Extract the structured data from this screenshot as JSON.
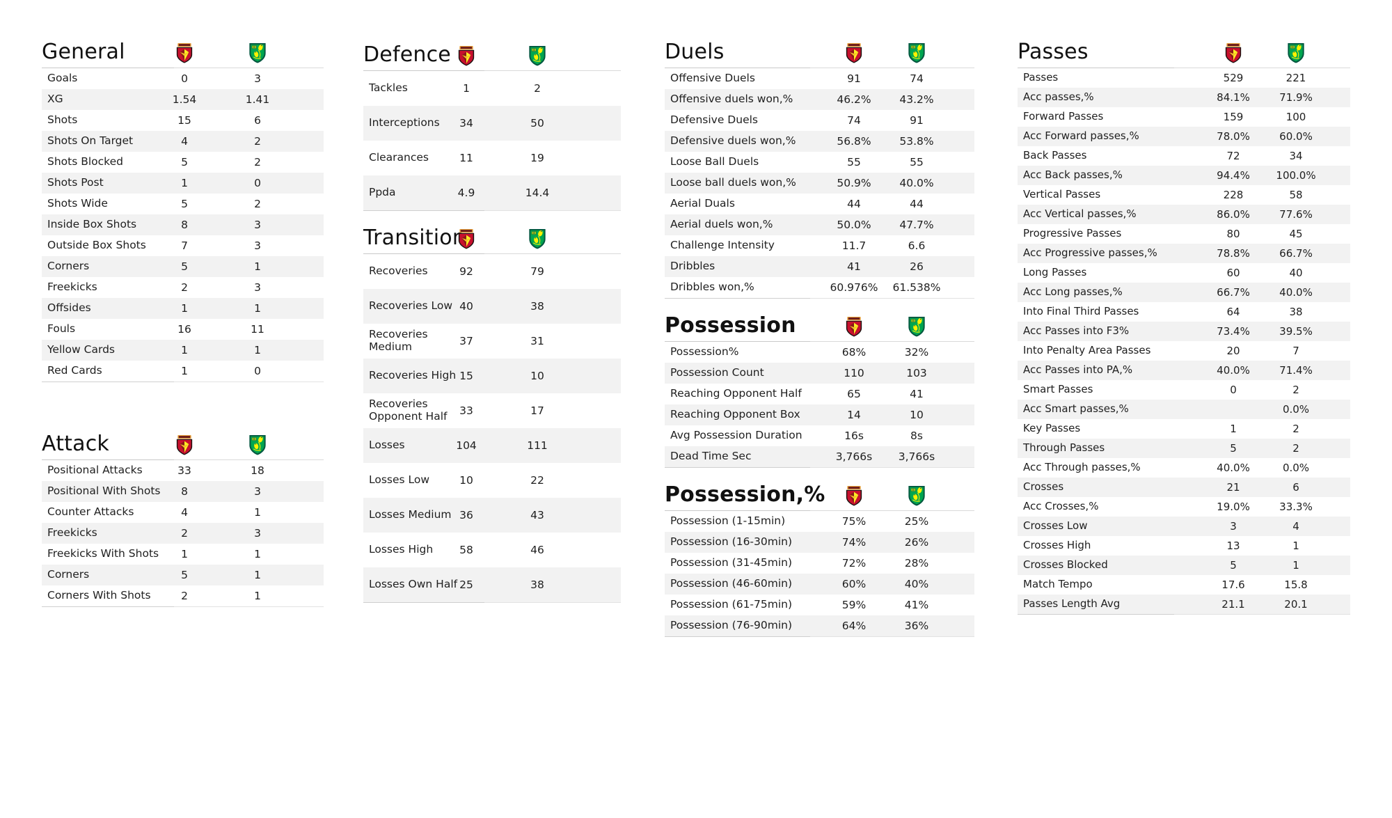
{
  "teams": {
    "home": {
      "name": "Watford",
      "crest": "watford-crest",
      "colors": {
        "primary": "#FBEE23",
        "secondary": "#ED2127",
        "dark": "#231F20"
      }
    },
    "away": {
      "name": "Norwich City",
      "crest": "norwich-city-crest",
      "colors": {
        "primary": "#00A650",
        "secondary": "#FFF200",
        "dark": "#00573F"
      }
    }
  },
  "theme": {
    "row_alt_bg": "#f2f2f2",
    "row_bg": "#ffffff",
    "rule": "#d9d9d9",
    "text": "#1f1f1f"
  },
  "columns": [
    {
      "name": "column-1",
      "sections": [
        {
          "title": "General",
          "bold": false,
          "rows": [
            {
              "label": "Goals",
              "home": "0",
              "away": "3"
            },
            {
              "label": "XG",
              "home": "1.54",
              "away": "1.41"
            },
            {
              "label": "Shots",
              "home": "15",
              "away": "6"
            },
            {
              "label": "Shots On Target",
              "home": "4",
              "away": "2"
            },
            {
              "label": "Shots Blocked",
              "home": "5",
              "away": "2"
            },
            {
              "label": "Shots Post",
              "home": "1",
              "away": "0"
            },
            {
              "label": "Shots Wide",
              "home": "5",
              "away": "2"
            },
            {
              "label": "Inside Box Shots",
              "home": "8",
              "away": "3"
            },
            {
              "label": "Outside Box Shots",
              "home": "7",
              "away": "3"
            },
            {
              "label": "Corners",
              "home": "5",
              "away": "1"
            },
            {
              "label": "Freekicks",
              "home": "2",
              "away": "3"
            },
            {
              "label": "Offsides",
              "home": "1",
              "away": "1"
            },
            {
              "label": "Fouls",
              "home": "16",
              "away": "11"
            },
            {
              "label": "Yellow Cards",
              "home": "1",
              "away": "1"
            },
            {
              "label": "Red Cards",
              "home": "1",
              "away": "0"
            }
          ]
        },
        {
          "title": "Attack",
          "bold": false,
          "rows": [
            {
              "label": "Positional Attacks",
              "home": "33",
              "away": "18"
            },
            {
              "label": "Positional With Shots",
              "home": "8",
              "away": "3"
            },
            {
              "label": "Counter Attacks",
              "home": "4",
              "away": "1"
            },
            {
              "label": "Freekicks",
              "home": "2",
              "away": "3"
            },
            {
              "label": "Freekicks With Shots",
              "home": "1",
              "away": "1"
            },
            {
              "label": "Corners",
              "home": "5",
              "away": "1"
            },
            {
              "label": "Corners With Shots",
              "home": "2",
              "away": "1"
            }
          ]
        }
      ]
    },
    {
      "name": "column-2",
      "sections": [
        {
          "title": "Defence",
          "bold": false,
          "rows": [
            {
              "label": "Tackles",
              "home": "1",
              "away": "2"
            },
            {
              "label": "Interceptions",
              "home": "34",
              "away": "50"
            },
            {
              "label": "Clearances",
              "home": "11",
              "away": "19"
            },
            {
              "label": "Ppda",
              "home": "4.9",
              "away": "14.4"
            }
          ]
        },
        {
          "title": "Transition",
          "bold": false,
          "rows": [
            {
              "label": "Recoveries",
              "home": "92",
              "away": "79"
            },
            {
              "label": "Recoveries Low",
              "home": "40",
              "away": "38"
            },
            {
              "label": "Recoveries\nMedium",
              "home": "37",
              "away": "31"
            },
            {
              "label": "Recoveries High",
              "home": "15",
              "away": "10"
            },
            {
              "label": "Recoveries\nOpponent Half",
              "home": "33",
              "away": "17"
            },
            {
              "label": "Losses",
              "home": "104",
              "away": "111"
            },
            {
              "label": "Losses Low",
              "home": "10",
              "away": "22"
            },
            {
              "label": "Losses Medium",
              "home": "36",
              "away": "43"
            },
            {
              "label": "Losses High",
              "home": "58",
              "away": "46"
            },
            {
              "label": "Losses Own Half",
              "home": "25",
              "away": "38"
            }
          ]
        }
      ]
    },
    {
      "name": "column-3",
      "sections": [
        {
          "title": "Duels",
          "bold": false,
          "rows": [
            {
              "label": "Offensive Duels",
              "home": "91",
              "away": "74"
            },
            {
              "label": "Offensive duels won,%",
              "home": "46.2%",
              "away": "43.2%"
            },
            {
              "label": "Defensive Duels",
              "home": "74",
              "away": "91"
            },
            {
              "label": "Defensive duels won,%",
              "home": "56.8%",
              "away": "53.8%"
            },
            {
              "label": "Loose Ball Duels",
              "home": "55",
              "away": "55"
            },
            {
              "label": "Loose ball duels won,%",
              "home": "50.9%",
              "away": "40.0%"
            },
            {
              "label": "Aerial Duals",
              "home": "44",
              "away": "44"
            },
            {
              "label": "Aerial duels won,%",
              "home": "50.0%",
              "away": "47.7%"
            },
            {
              "label": "Challenge Intensity",
              "home": "11.7",
              "away": "6.6"
            },
            {
              "label": "Dribbles",
              "home": "41",
              "away": "26"
            },
            {
              "label": "Dribbles won,%",
              "home": "60.976%",
              "away": "61.538%"
            }
          ]
        },
        {
          "title": "Possession",
          "bold": true,
          "rows": [
            {
              "label": "Possession%",
              "home": "68%",
              "away": "32%"
            },
            {
              "label": "Possession Count",
              "home": "110",
              "away": "103"
            },
            {
              "label": "Reaching Opponent Half",
              "home": "65",
              "away": "41"
            },
            {
              "label": "Reaching Opponent Box",
              "home": "14",
              "away": "10"
            },
            {
              "label": "Avg Possession Duration",
              "home": "16s",
              "away": "8s"
            },
            {
              "label": "Dead Time Sec",
              "home": "3,766s",
              "away": "3,766s"
            }
          ]
        },
        {
          "title": "Possession,%",
          "bold": true,
          "rows": [
            {
              "label": "Possession (1-15min)",
              "home": "75%",
              "away": "25%"
            },
            {
              "label": "Possession (16-30min)",
              "home": "74%",
              "away": "26%"
            },
            {
              "label": "Possession (31-45min)",
              "home": "72%",
              "away": "28%"
            },
            {
              "label": "Possession (46-60min)",
              "home": "60%",
              "away": "40%"
            },
            {
              "label": "Possession (61-75min)",
              "home": "59%",
              "away": "41%"
            },
            {
              "label": "Possession (76-90min)",
              "home": "64%",
              "away": "36%"
            }
          ]
        }
      ]
    },
    {
      "name": "column-4",
      "sections": [
        {
          "title": "Passes",
          "bold": false,
          "rows": [
            {
              "label": "Passes",
              "home": "529",
              "away": "221"
            },
            {
              "label": "Acc passes,%",
              "home": "84.1%",
              "away": "71.9%"
            },
            {
              "label": "Forward Passes",
              "home": "159",
              "away": "100"
            },
            {
              "label": "Acc Forward passes,%",
              "home": "78.0%",
              "away": "60.0%"
            },
            {
              "label": "Back Passes",
              "home": "72",
              "away": "34"
            },
            {
              "label": "Acc Back passes,%",
              "home": "94.4%",
              "away": "100.0%"
            },
            {
              "label": "Vertical Passes",
              "home": "228",
              "away": "58"
            },
            {
              "label": "Acc Vertical passes,%",
              "home": "86.0%",
              "away": "77.6%"
            },
            {
              "label": "Progressive Passes",
              "home": "80",
              "away": "45"
            },
            {
              "label": "Acc Progressive passes,%",
              "home": "78.8%",
              "away": "66.7%"
            },
            {
              "label": "Long Passes",
              "home": "60",
              "away": "40"
            },
            {
              "label": "Acc Long passes,%",
              "home": "66.7%",
              "away": "40.0%"
            },
            {
              "label": "Into Final Third Passes",
              "home": "64",
              "away": "38"
            },
            {
              "label": "Acc Passes into F3%",
              "home": "73.4%",
              "away": "39.5%"
            },
            {
              "label": "Into Penalty Area Passes",
              "home": "20",
              "away": "7"
            },
            {
              "label": "Acc Passes into PA,%",
              "home": "40.0%",
              "away": "71.4%"
            },
            {
              "label": "Smart Passes",
              "home": "0",
              "away": "2"
            },
            {
              "label": "Acc Smart passes,%",
              "home": "",
              "away": "0.0%"
            },
            {
              "label": "Key Passes",
              "home": "1",
              "away": "2"
            },
            {
              "label": "Through Passes",
              "home": "5",
              "away": "2"
            },
            {
              "label": "Acc Through passes,%",
              "home": "40.0%",
              "away": "0.0%"
            },
            {
              "label": "Crosses",
              "home": "21",
              "away": "6"
            },
            {
              "label": "Acc Crosses,%",
              "home": "19.0%",
              "away": "33.3%"
            },
            {
              "label": "Crosses Low",
              "home": "3",
              "away": "4"
            },
            {
              "label": "Crosses High",
              "home": "13",
              "away": "1"
            },
            {
              "label": "Crosses Blocked",
              "home": "5",
              "away": "1"
            },
            {
              "label": "Match Tempo",
              "home": "17.6",
              "away": "15.8"
            },
            {
              "label": "Passes Length Avg",
              "home": "21.1",
              "away": "20.1"
            }
          ]
        }
      ]
    }
  ]
}
